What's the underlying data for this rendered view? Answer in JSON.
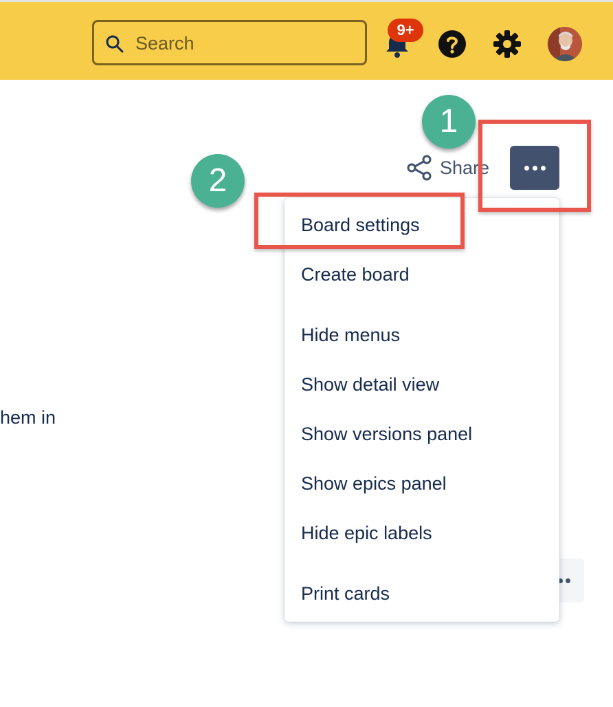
{
  "header": {
    "search_placeholder": "Search",
    "notifications_badge": "9+",
    "colors": {
      "bar": "#f6cc48",
      "badge": "#de350b"
    }
  },
  "toolbar": {
    "share_label": "Share"
  },
  "callouts": {
    "step1": "1",
    "step2": "2"
  },
  "menu": {
    "items": [
      "Board settings",
      "Create board",
      "Hide menus",
      "Show detail view",
      "Show versions panel",
      "Show epics panel",
      "Hide epic labels",
      "Print cards"
    ]
  },
  "background": {
    "partial_text": "hem in"
  }
}
